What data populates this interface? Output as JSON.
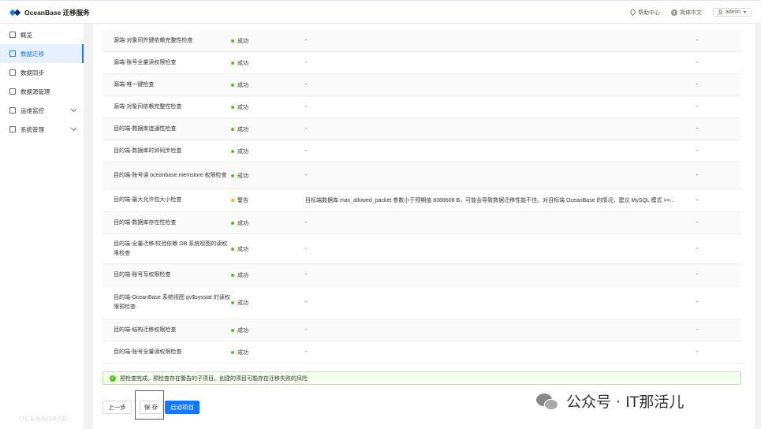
{
  "app": {
    "title": "OceanBase 迁移服务"
  },
  "topbar": {
    "help": "帮助中心",
    "language": "简体中文",
    "user": "admin"
  },
  "sidebar": {
    "items": [
      {
        "label": "概览",
        "icon": "grid-icon"
      },
      {
        "label": "数据迁移",
        "icon": "migrate-icon",
        "active": true
      },
      {
        "label": "数据同步",
        "icon": "sync-icon"
      },
      {
        "label": "数据源管理",
        "icon": "datasource-icon"
      },
      {
        "label": "运维监控",
        "icon": "monitor-icon",
        "expandable": true
      },
      {
        "label": "系统管理",
        "icon": "settings-icon",
        "expandable": true
      }
    ],
    "footer": "OCEANBASE"
  },
  "checks": [
    {
      "item": "源端-对象间外键依赖完整性检查",
      "status": "成功",
      "detail": "-",
      "action": "-"
    },
    {
      "item": "源端-账号全量读权限检查",
      "status": "成功",
      "detail": "-",
      "action": "-"
    },
    {
      "item": "源端-唯一键检查",
      "status": "成功",
      "detail": "-",
      "action": "-"
    },
    {
      "item": "源端-对象间依赖完整性检查",
      "status": "成功",
      "detail": "-",
      "action": "-"
    },
    {
      "item": "目的端-数据库连通性检查",
      "status": "成功",
      "detail": "-",
      "action": "-"
    },
    {
      "item": "目的端-数据库时钟同步检查",
      "status": "成功",
      "detail": "-",
      "action": "-"
    },
    {
      "item": "目的端-账号读 oceanbase.memstore 权限检查",
      "status": "成功",
      "detail": "-",
      "action": "-"
    },
    {
      "item": "目的端-最大允许包大小检查",
      "status": "警告",
      "detail": "目标端数据库 max_allowed_packet 参数小于预期值 8388608 B，可能会导致数据迁移性能不佳。对目标端 OceanBase 的情况，建议 MySQL 模式 >=...",
      "action": "-"
    },
    {
      "item": "目的端-数据库存在性检查",
      "status": "成功",
      "detail": "-",
      "action": "-"
    },
    {
      "item": "目的端-全量迁移/校验依赖 OB 系统视图的读权限检查",
      "status": "成功",
      "detail": "-",
      "action": "-"
    },
    {
      "item": "目的端-账号写权限检查",
      "status": "成功",
      "detail": "-",
      "action": "-"
    },
    {
      "item": "目的端-OceanBase 系统视图 gv$sysstat 的读权限预检查",
      "status": "成功",
      "detail": "-",
      "action": "-"
    },
    {
      "item": "目的端-结构迁移权限检查",
      "status": "成功",
      "detail": "-",
      "action": "-"
    },
    {
      "item": "目的端-账号全量读权限检查",
      "status": "成功",
      "detail": "-",
      "action": "-"
    }
  ],
  "alert": {
    "message": "预检查完成。预检查存在警告的子项目，创建的项目可能存在迁移失败的风险"
  },
  "buttons": {
    "prev": "上一步",
    "save": "保 存",
    "start": "启动项目"
  },
  "watermark": "公众号 · IT那活儿",
  "colors": {
    "primary": "#1677ff",
    "success": "#52c41a",
    "warning": "#faad14",
    "highlight": "#e02020"
  }
}
